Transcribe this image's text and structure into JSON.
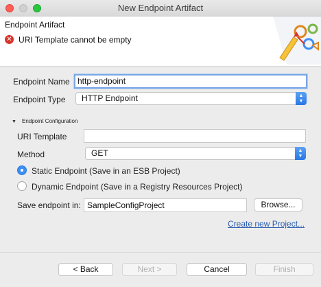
{
  "window": {
    "title": "New Endpoint Artifact"
  },
  "banner": {
    "title": "Endpoint Artifact",
    "error_message": "URI Template cannot be empty",
    "error_icon": "error-icon",
    "graphic_icon": "endpoint-wizard-graphic"
  },
  "form": {
    "endpoint_name": {
      "label": "Endpoint Name",
      "value": "http-endpoint"
    },
    "endpoint_type": {
      "label": "Endpoint Type",
      "value": "HTTP Endpoint"
    }
  },
  "config": {
    "section_title": "Endpoint Configuration",
    "uri_template": {
      "label": "URI Template",
      "value": ""
    },
    "method": {
      "label": "Method",
      "value": "GET"
    },
    "static_option": {
      "label": "Static Endpoint (Save in an ESB Project)",
      "selected": true
    },
    "dynamic_option": {
      "label": "Dynamic Endpoint (Save in a Registry Resources Project)",
      "selected": false
    },
    "save_in": {
      "label": "Save endpoint in:",
      "value": "SampleConfigProject",
      "browse_label": "Browse..."
    },
    "create_project_link": "Create new Project..."
  },
  "footer": {
    "back_label": "< Back",
    "next_label": "Next >",
    "cancel_label": "Cancel",
    "finish_label": "Finish"
  },
  "colors": {
    "accent": "#3b8ff5",
    "error": "#d9342b",
    "link": "#2a5db0"
  }
}
